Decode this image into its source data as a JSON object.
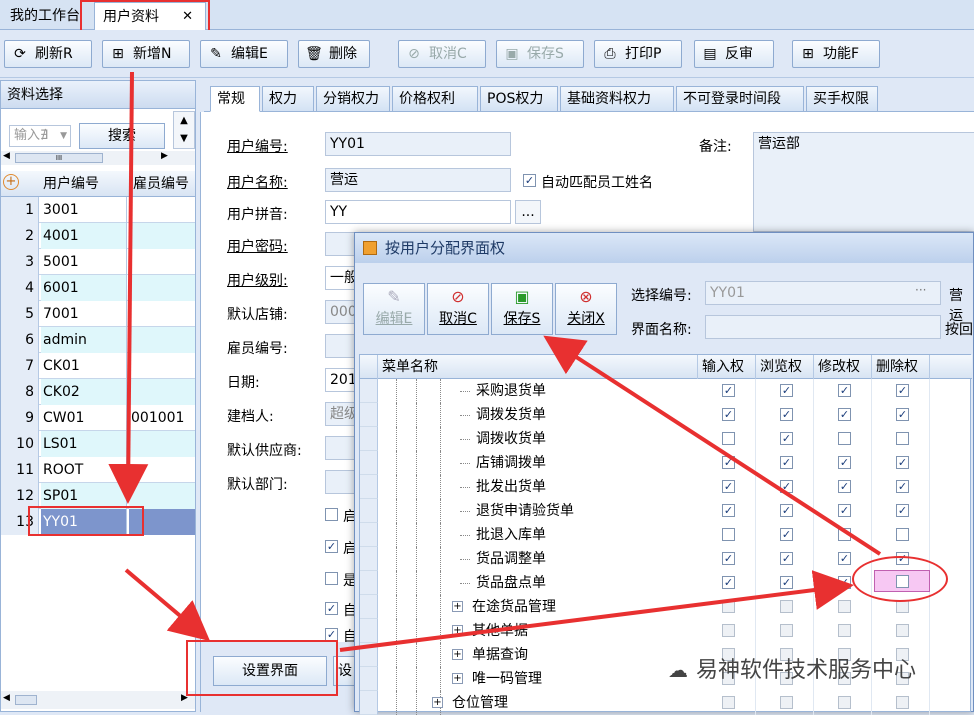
{
  "tabs": [
    {
      "label": "我的工作台"
    },
    {
      "label": "用户资料",
      "close": "✕"
    }
  ],
  "toolbar": [
    {
      "label": "刷新R",
      "icon": "refresh-icon",
      "glyph": "⟳",
      "disabled": false
    },
    {
      "label": "新增N",
      "icon": "add-icon",
      "glyph": "⊞",
      "disabled": false
    },
    {
      "label": "编辑E",
      "icon": "edit-icon",
      "glyph": "✎",
      "disabled": false
    },
    {
      "label": "删除",
      "icon": "trash-icon",
      "glyph": "🗑",
      "disabled": false
    },
    {
      "label": "取消C",
      "icon": "cancel-icon",
      "glyph": "⊘",
      "disabled": true
    },
    {
      "label": "保存S",
      "icon": "save-icon",
      "glyph": "▣",
      "disabled": true
    },
    {
      "label": "打印P",
      "icon": "print-icon",
      "glyph": "⎙",
      "disabled": false
    },
    {
      "label": "反审",
      "icon": "unaudit-icon",
      "glyph": "▤",
      "disabled": false
    },
    {
      "label": "功能F",
      "icon": "function-icon",
      "glyph": "⊞",
      "disabled": false
    }
  ],
  "left": {
    "title": "资料选择",
    "search_placeholder": "输入∄",
    "search_button": "搜索",
    "scroll_mark": "III",
    "headers": [
      "用户编号",
      "雇员编号"
    ],
    "rows": [
      {
        "n": "1",
        "code": "3001",
        "emp": ""
      },
      {
        "n": "2",
        "code": "4001",
        "emp": ""
      },
      {
        "n": "3",
        "code": "5001",
        "emp": ""
      },
      {
        "n": "4",
        "code": "6001",
        "emp": ""
      },
      {
        "n": "5",
        "code": "7001",
        "emp": ""
      },
      {
        "n": "6",
        "code": "admin",
        "emp": ""
      },
      {
        "n": "7",
        "code": "CK01",
        "emp": ""
      },
      {
        "n": "8",
        "code": "CK02",
        "emp": ""
      },
      {
        "n": "9",
        "code": "CW01",
        "emp": "001001"
      },
      {
        "n": "10",
        "code": "LS01",
        "emp": ""
      },
      {
        "n": "11",
        "code": "ROOT",
        "emp": ""
      },
      {
        "n": "12",
        "code": "SP01",
        "emp": ""
      },
      {
        "n": "13",
        "code": "YY01",
        "emp": ""
      }
    ]
  },
  "subtabs": [
    "常规",
    "权力",
    "分销权力",
    "价格权利",
    "POS权力",
    "基础资料权力",
    "不可登录时间段",
    "买手权限"
  ],
  "form": {
    "user_code_label": "用户编号:",
    "user_code": "YY01",
    "user_name_label": "用户名称:",
    "user_name": "营运",
    "auto_match_label": "自动匹配员工姓名",
    "pinyin_label": "用户拼音:",
    "pinyin": "YY",
    "pinyin_btn": "...",
    "password_label": "用户密码:",
    "level_label": "用户级别:",
    "level": "一般",
    "shop_label": "默认店铺:",
    "shop": "000",
    "emp_label": "雇员编号:",
    "date_label": "日期:",
    "date": "201",
    "creator_label": "建档人:",
    "creator": "超级",
    "supplier_label": "默认供应商:",
    "dept_label": "默认部门:",
    "remark_label": "备注:",
    "remark": "营运部",
    "cb_labels": [
      "启",
      "启",
      "是",
      "自",
      "自"
    ],
    "set_ui_button": "设置界面",
    "set2_button": "设"
  },
  "dialog": {
    "title": "按用户分配界面权",
    "buttons": [
      {
        "label": "编辑E",
        "glyph": "✎",
        "icon": "edit-icon",
        "disabled": true
      },
      {
        "label": "取消C",
        "glyph": "⊘",
        "icon": "cancel-icon",
        "disabled": false
      },
      {
        "label": "保存S",
        "glyph": "▣",
        "icon": "save-icon",
        "disabled": false
      },
      {
        "label": "关闭X",
        "glyph": "⊗",
        "icon": "close-icon",
        "disabled": false
      }
    ],
    "select_code_label": "选择编号:",
    "select_code": "YY01",
    "select_btn": "···",
    "select_name_cut": "营运",
    "ui_name_label": "界面名称:",
    "return_cut": "按回",
    "headers": [
      "菜单名称",
      "输入权",
      "浏览权",
      "修改权",
      "删除权"
    ],
    "rows": [
      {
        "name": "采购退货单",
        "level": 2,
        "expand": false,
        "checks": [
          true,
          true,
          true,
          true
        ]
      },
      {
        "name": "调拨发货单",
        "level": 2,
        "expand": false,
        "checks": [
          true,
          true,
          true,
          true
        ]
      },
      {
        "name": "调拨收货单",
        "level": 2,
        "expand": false,
        "checks": [
          false,
          true,
          false,
          false
        ]
      },
      {
        "name": "店铺调拨单",
        "level": 2,
        "expand": false,
        "checks": [
          true,
          true,
          true,
          true
        ]
      },
      {
        "name": "批发出货单",
        "level": 2,
        "expand": false,
        "checks": [
          true,
          true,
          true,
          true
        ]
      },
      {
        "name": "退货申请验货单",
        "level": 2,
        "expand": false,
        "checks": [
          true,
          true,
          true,
          true
        ]
      },
      {
        "name": "批退入库单",
        "level": 2,
        "expand": false,
        "checks": [
          false,
          true,
          false,
          false
        ]
      },
      {
        "name": "货品调整单",
        "level": 2,
        "expand": false,
        "checks": [
          true,
          true,
          true,
          true
        ]
      },
      {
        "name": "货品盘点单",
        "level": 2,
        "expand": false,
        "checks": [
          true,
          true,
          true,
          false
        ]
      },
      {
        "name": "在途货品管理",
        "level": 1,
        "expand": true,
        "checks": [
          false,
          false,
          false,
          false
        ]
      },
      {
        "name": "其他单据",
        "level": 1,
        "expand": true,
        "checks": [
          false,
          false,
          false,
          false
        ]
      },
      {
        "name": "单据查询",
        "level": 1,
        "expand": true,
        "checks": [
          false,
          false,
          false,
          false
        ]
      },
      {
        "name": "唯一码管理",
        "level": 1,
        "expand": true,
        "checks": [
          false,
          false,
          false,
          false
        ]
      },
      {
        "name": "仓位管理",
        "level": 0,
        "expand": true,
        "checks": [
          false,
          false,
          false,
          false
        ]
      }
    ]
  },
  "watermark": "易神软件技术服务中心",
  "colors": {
    "accent": "#e83030",
    "highlight": "#f7c8f3",
    "selected": "#7d95cc",
    "cyan": "#dff7fb"
  }
}
